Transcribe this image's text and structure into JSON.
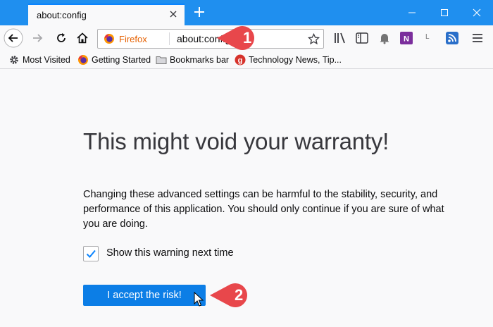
{
  "tab": {
    "title": "about:config"
  },
  "urlbar": {
    "identity": "Firefox",
    "url": "about:config"
  },
  "bookmarks": [
    {
      "label": "Most Visited"
    },
    {
      "label": "Getting Started"
    },
    {
      "label": "Bookmarks bar"
    },
    {
      "label": "Technology News, Tip..."
    }
  ],
  "toolbar": {
    "extension_letter": "L"
  },
  "warning": {
    "title": "This might void your warranty!",
    "message": "Changing these advanced settings can be harmful to the stability, security, and performance of this application. You should only continue if you are sure of what you are doing.",
    "checkbox_label": "Show this warning next time",
    "checkbox_checked": true,
    "accept_label": "I accept the risk!"
  },
  "callouts": [
    {
      "number": "1"
    },
    {
      "number": "2"
    }
  ],
  "colors": {
    "titlebar": "#1f8fef",
    "accent": "#0c7ee6",
    "callout": "#e8474b"
  }
}
